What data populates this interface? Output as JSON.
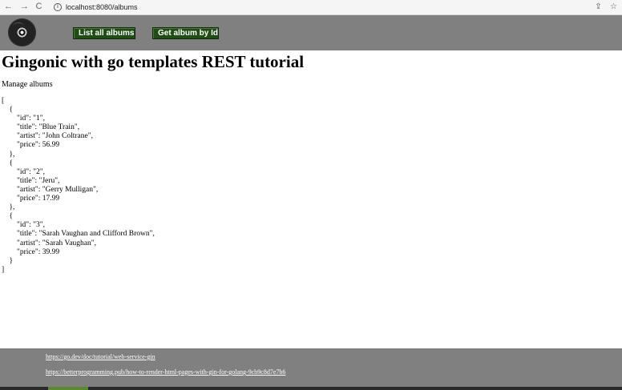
{
  "browser": {
    "back_icon": "←",
    "forward_icon": "→",
    "reload_icon": "C",
    "info_icon": "i",
    "url": "localhost:8080/albums",
    "share_icon": "⇪",
    "star_icon": "☆"
  },
  "header": {
    "list_button": "List all albums",
    "get_button": "Get album by Id",
    "button_color": "#1f4d14",
    "bar_color": "#808080"
  },
  "main": {
    "title": "Gingonic with go templates REST tutorial",
    "subtitle": "Manage albums",
    "albums": [
      {
        "id": "1",
        "title": "Blue Train",
        "artist": "John Coltrane",
        "price": "56.99"
      },
      {
        "id": "2",
        "title": "Jeru",
        "artist": "Gerry Mulligan",
        "price": "17.99"
      },
      {
        "id": "3",
        "title": "Sarah Vaughan and Clifford Brown",
        "artist": "Sarah Vaughan",
        "price": "39.99"
      }
    ]
  },
  "footer": {
    "link1": "https://go.dev/doc/tutorial/web-service-gin",
    "link2": "https://betterprogramming.pub/how-to-render-html-pages-with-gin-for-golang-9cb9c8d7e7b6"
  }
}
